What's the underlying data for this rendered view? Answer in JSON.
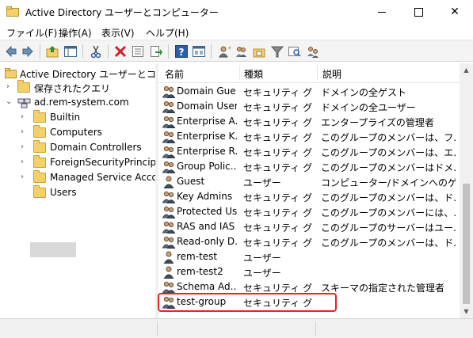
{
  "window": {
    "title": "Active Directory ユーザーとコンピューター",
    "controls": {
      "minimize": "minimize",
      "maximize": "maximize",
      "close": "✕"
    }
  },
  "menu": [
    "ファイル(F)",
    "操作(A)",
    "表示(V)",
    "ヘルプ(H)"
  ],
  "toolbar": {
    "icons": [
      "back-icon",
      "forward-icon",
      "up-folder-icon",
      "show-tree-icon",
      "cut-icon",
      "delete-icon",
      "properties-icon",
      "export-icon",
      "help-icon",
      "console-icon",
      "new-user-icon",
      "new-group-icon",
      "new-ou-icon",
      "filter-icon",
      "find-icon",
      "add-to-group-icon"
    ]
  },
  "tree": {
    "root": "Active Directory ユーザーとコンピュー",
    "saved_queries": "保存されたクエリ",
    "domain": "ad.rem-system.com",
    "children": [
      "Builtin",
      "Computers",
      "Domain Controllers",
      "ForeignSecurityPrincipals",
      "Managed Service Accounts",
      "Users"
    ],
    "selected": "Users"
  },
  "list": {
    "columns": [
      "名前",
      "種類",
      "説明"
    ],
    "rows": [
      {
        "name": "Domain Gue...",
        "type": "セキュリティ グル...",
        "desc": "ドメインの全ゲスト",
        "icon": "group-icon"
      },
      {
        "name": "Domain Users",
        "type": "セキュリティ グル...",
        "desc": "ドメインの全ユーザー",
        "icon": "group-icon"
      },
      {
        "name": "Enterprise A...",
        "type": "セキュリティ グル...",
        "desc": "エンタープライズの管理者",
        "icon": "group-icon"
      },
      {
        "name": "Enterprise K...",
        "type": "セキュリティ グル...",
        "desc": "このグループのメンバーは、フ...",
        "icon": "group-icon"
      },
      {
        "name": "Enterprise R...",
        "type": "セキュリティ グル...",
        "desc": "このグループのメンバーは、エ...",
        "icon": "group-icon"
      },
      {
        "name": "Group Polic...",
        "type": "セキュリティ グル...",
        "desc": "このグループのメンバーはドメ...",
        "icon": "group-icon"
      },
      {
        "name": "Guest",
        "type": "ユーザー",
        "desc": "コンピューター/ドメインへのゲ...",
        "icon": "user-icon"
      },
      {
        "name": "Key Admins",
        "type": "セキュリティ グル...",
        "desc": "このグループのメンバーは、ド...",
        "icon": "group-icon"
      },
      {
        "name": "Protected Us...",
        "type": "セキュリティ グル...",
        "desc": "このグループのメンバーには、...",
        "icon": "group-icon"
      },
      {
        "name": "RAS and IAS ...",
        "type": "セキュリティ グル...",
        "desc": "このグループのサーバーはユー...",
        "icon": "group-icon"
      },
      {
        "name": "Read-only D...",
        "type": "セキュリティ グル...",
        "desc": "このグループのメンバーは、ド...",
        "icon": "group-icon"
      },
      {
        "name": "rem-test",
        "type": "ユーザー",
        "desc": "",
        "icon": "user-icon"
      },
      {
        "name": "rem-test2",
        "type": "ユーザー",
        "desc": "",
        "icon": "user-icon"
      },
      {
        "name": "Schema Ad...",
        "type": "セキュリティ グル...",
        "desc": "スキーマの指定された管理者",
        "icon": "group-icon"
      },
      {
        "name": "test-group",
        "type": "セキュリティ グル...",
        "desc": "",
        "icon": "group-icon"
      }
    ],
    "highlighted_row": "test-group"
  },
  "colors": {
    "highlight_border": "#e8212b",
    "folder": "#f4d06a",
    "selection": "#d9d9d9"
  }
}
